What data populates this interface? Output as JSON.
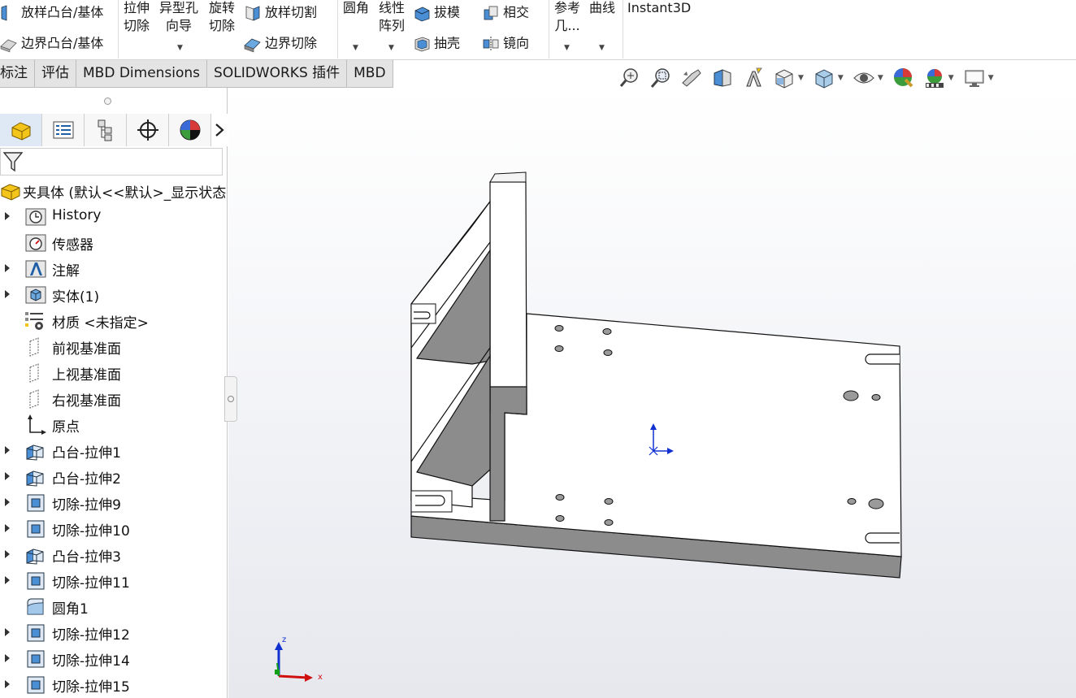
{
  "ribbon": {
    "loft_boss": "放样凸台/基体",
    "boundary_boss": "边界凸台/基体",
    "extrude_cut_l1": "拉伸",
    "extrude_cut_l2": "切除",
    "hole_wizard_l1": "异型孔",
    "hole_wizard_l2": "向导",
    "revolve_cut_l1": "旋转",
    "revolve_cut_l2": "切除",
    "loft_cut": "放样切割",
    "boundary_cut": "边界切除",
    "fillet": "圆角",
    "linear_pattern_l1": "线性",
    "linear_pattern_l2": "阵列",
    "draft": "拔模",
    "intersect": "相交",
    "shell": "抽壳",
    "mirror": "镜向",
    "ref_geom_l1": "参考",
    "ref_geom_l2": "几...",
    "curves": "曲线",
    "instant3d": "Instant3D"
  },
  "tabs": [
    "标注",
    "评估",
    "MBD Dimensions",
    "SOLIDWORKS 插件",
    "MBD"
  ],
  "tree": {
    "root_label": "夹具体 (默认<<默认>_显示状态",
    "items": [
      {
        "label": "History",
        "icon": "history-icon",
        "expandable": true
      },
      {
        "label": "传感器",
        "icon": "sensor-icon",
        "expandable": false
      },
      {
        "label": "注解",
        "icon": "annotation-icon",
        "expandable": true
      },
      {
        "label": "实体(1)",
        "icon": "solid-bodies-icon",
        "expandable": true
      },
      {
        "label": "材质 <未指定>",
        "icon": "material-icon",
        "expandable": false
      },
      {
        "label": "前视基准面",
        "icon": "plane-icon",
        "expandable": false
      },
      {
        "label": "上视基准面",
        "icon": "plane-icon",
        "expandable": false
      },
      {
        "label": "右视基准面",
        "icon": "plane-icon",
        "expandable": false
      },
      {
        "label": "原点",
        "icon": "origin-icon",
        "expandable": false
      },
      {
        "label": "凸台-拉伸1",
        "icon": "boss-extrude-icon",
        "expandable": true
      },
      {
        "label": "凸台-拉伸2",
        "icon": "boss-extrude-icon",
        "expandable": true
      },
      {
        "label": "切除-拉伸9",
        "icon": "cut-extrude-icon",
        "expandable": true
      },
      {
        "label": "切除-拉伸10",
        "icon": "cut-extrude-icon",
        "expandable": true
      },
      {
        "label": "凸台-拉伸3",
        "icon": "boss-extrude-icon",
        "expandable": true
      },
      {
        "label": "切除-拉伸11",
        "icon": "cut-extrude-icon",
        "expandable": true
      },
      {
        "label": "圆角1",
        "icon": "fillet-icon",
        "expandable": false
      },
      {
        "label": "切除-拉伸12",
        "icon": "cut-extrude-icon",
        "expandable": true
      },
      {
        "label": "切除-拉伸14",
        "icon": "cut-extrude-icon",
        "expandable": true
      },
      {
        "label": "切除-拉伸15",
        "icon": "cut-extrude-icon",
        "expandable": true
      }
    ]
  },
  "triad": {
    "x_label": "x",
    "z_label": "z"
  },
  "colors": {
    "accent": "#1f6fd1",
    "model_face": "#ffffff",
    "model_shade": "#8c8c8c",
    "triad_x": "#d01010",
    "triad_y": "#14a014",
    "triad_z": "#1030d0"
  }
}
